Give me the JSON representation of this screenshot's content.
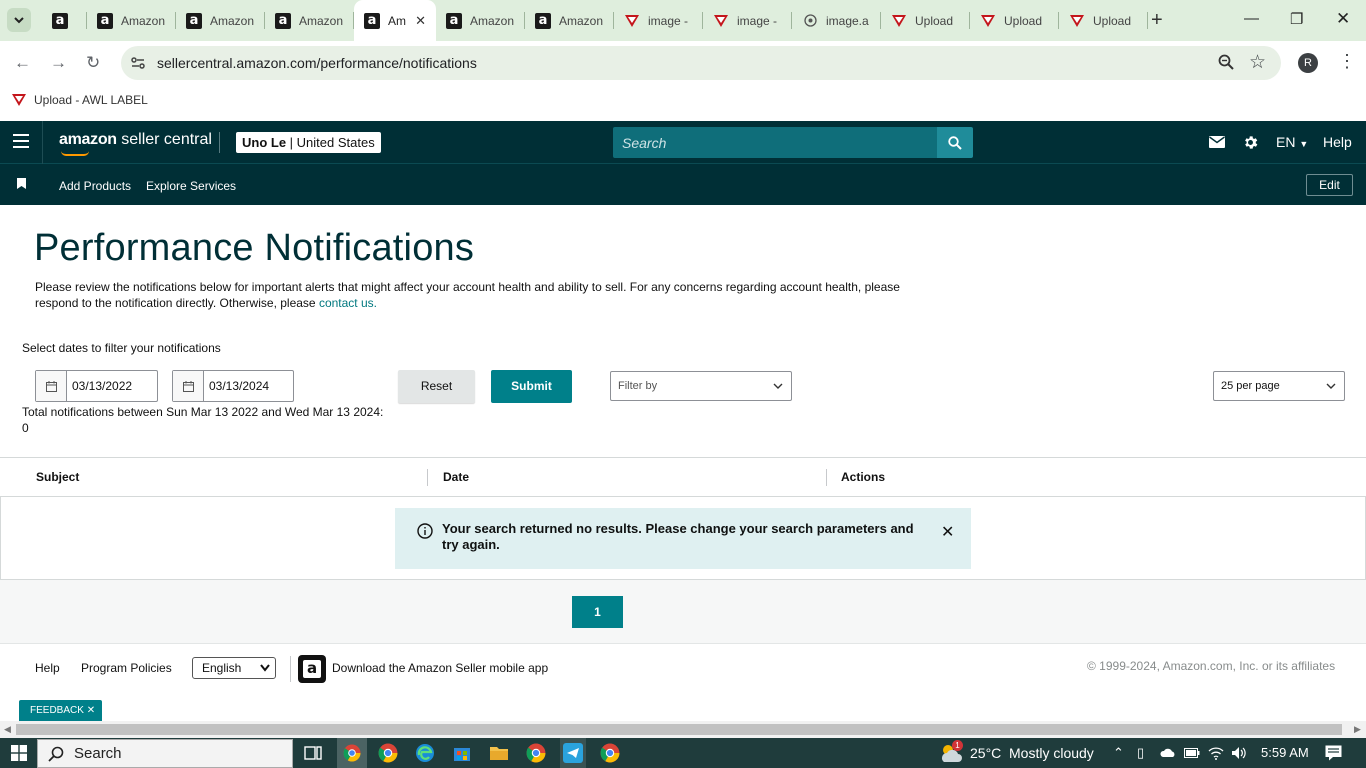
{
  "browser": {
    "tabs": [
      {
        "title": "",
        "icon": "amazon-a",
        "active": false
      },
      {
        "title": "Amazon",
        "icon": "amazon-a",
        "active": false
      },
      {
        "title": "Amazon",
        "icon": "amazon-a",
        "active": false
      },
      {
        "title": "Amazon",
        "icon": "amazon-a",
        "active": false
      },
      {
        "title": "Am",
        "icon": "amazon-a",
        "active": true
      },
      {
        "title": "Amazon",
        "icon": "amazon-a",
        "active": false
      },
      {
        "title": "Amazon",
        "icon": "amazon-a",
        "active": false
      },
      {
        "title": "image -",
        "icon": "awl-label",
        "active": false
      },
      {
        "title": "image -",
        "icon": "awl-label",
        "active": false
      },
      {
        "title": "image.a",
        "icon": "globe",
        "active": false
      },
      {
        "title": "Upload",
        "icon": "awl-label",
        "active": false
      },
      {
        "title": "Upload",
        "icon": "awl-label",
        "active": false
      },
      {
        "title": "Upload",
        "icon": "awl-label",
        "active": false
      }
    ],
    "url": "sellercentral.amazon.com/performance/notifications",
    "profile_initial": "R",
    "bookmark": "Upload - AWL LABEL"
  },
  "header": {
    "logo_brand": "amazon",
    "logo_product": "seller central",
    "account_name": "Uno Le",
    "account_region": "United States",
    "search_placeholder": "Search",
    "language": "EN",
    "help": "Help"
  },
  "nav": {
    "links": [
      "Add Products",
      "Explore Services"
    ],
    "edit": "Edit"
  },
  "page": {
    "title": "Performance Notifications",
    "intro": "Please review the notifications below for important alerts that might affect your account health and ability to sell. For any concerns regarding account health, please respond to the notification directly. Otherwise, please ",
    "intro_link": "contact us.",
    "filter_label": "Select dates to filter your notifications",
    "date_from": "03/13/2022",
    "date_to": "03/13/2024",
    "reset": "Reset",
    "submit": "Submit",
    "filter_by": "Filter by",
    "per_page": "25 per page",
    "total": "Total notifications between Sun Mar 13 2022 and Wed Mar 13 2024: 0"
  },
  "table": {
    "columns": [
      "Subject",
      "Date",
      "Actions"
    ],
    "empty_message": "Your search returned no results. Please change your search parameters and try again."
  },
  "pagination": {
    "current_page": "1"
  },
  "footer": {
    "help": "Help",
    "program_policies": "Program Policies",
    "language": "English",
    "mobile_app": "Download the Amazon Seller mobile app",
    "copyright": "© 1999-2024, Amazon.com, Inc. or its affiliates",
    "feedback": "FEEDBACK"
  },
  "taskbar": {
    "search": "Search",
    "weather_temp": "25°C",
    "weather_desc": "Mostly cloudy",
    "weather_badge": "1",
    "time": "5:59 AM"
  },
  "colors": {
    "header_bg": "#002f36",
    "accent": "#00808a",
    "link": "#00787f",
    "alert_bg": "#dff0f1"
  }
}
